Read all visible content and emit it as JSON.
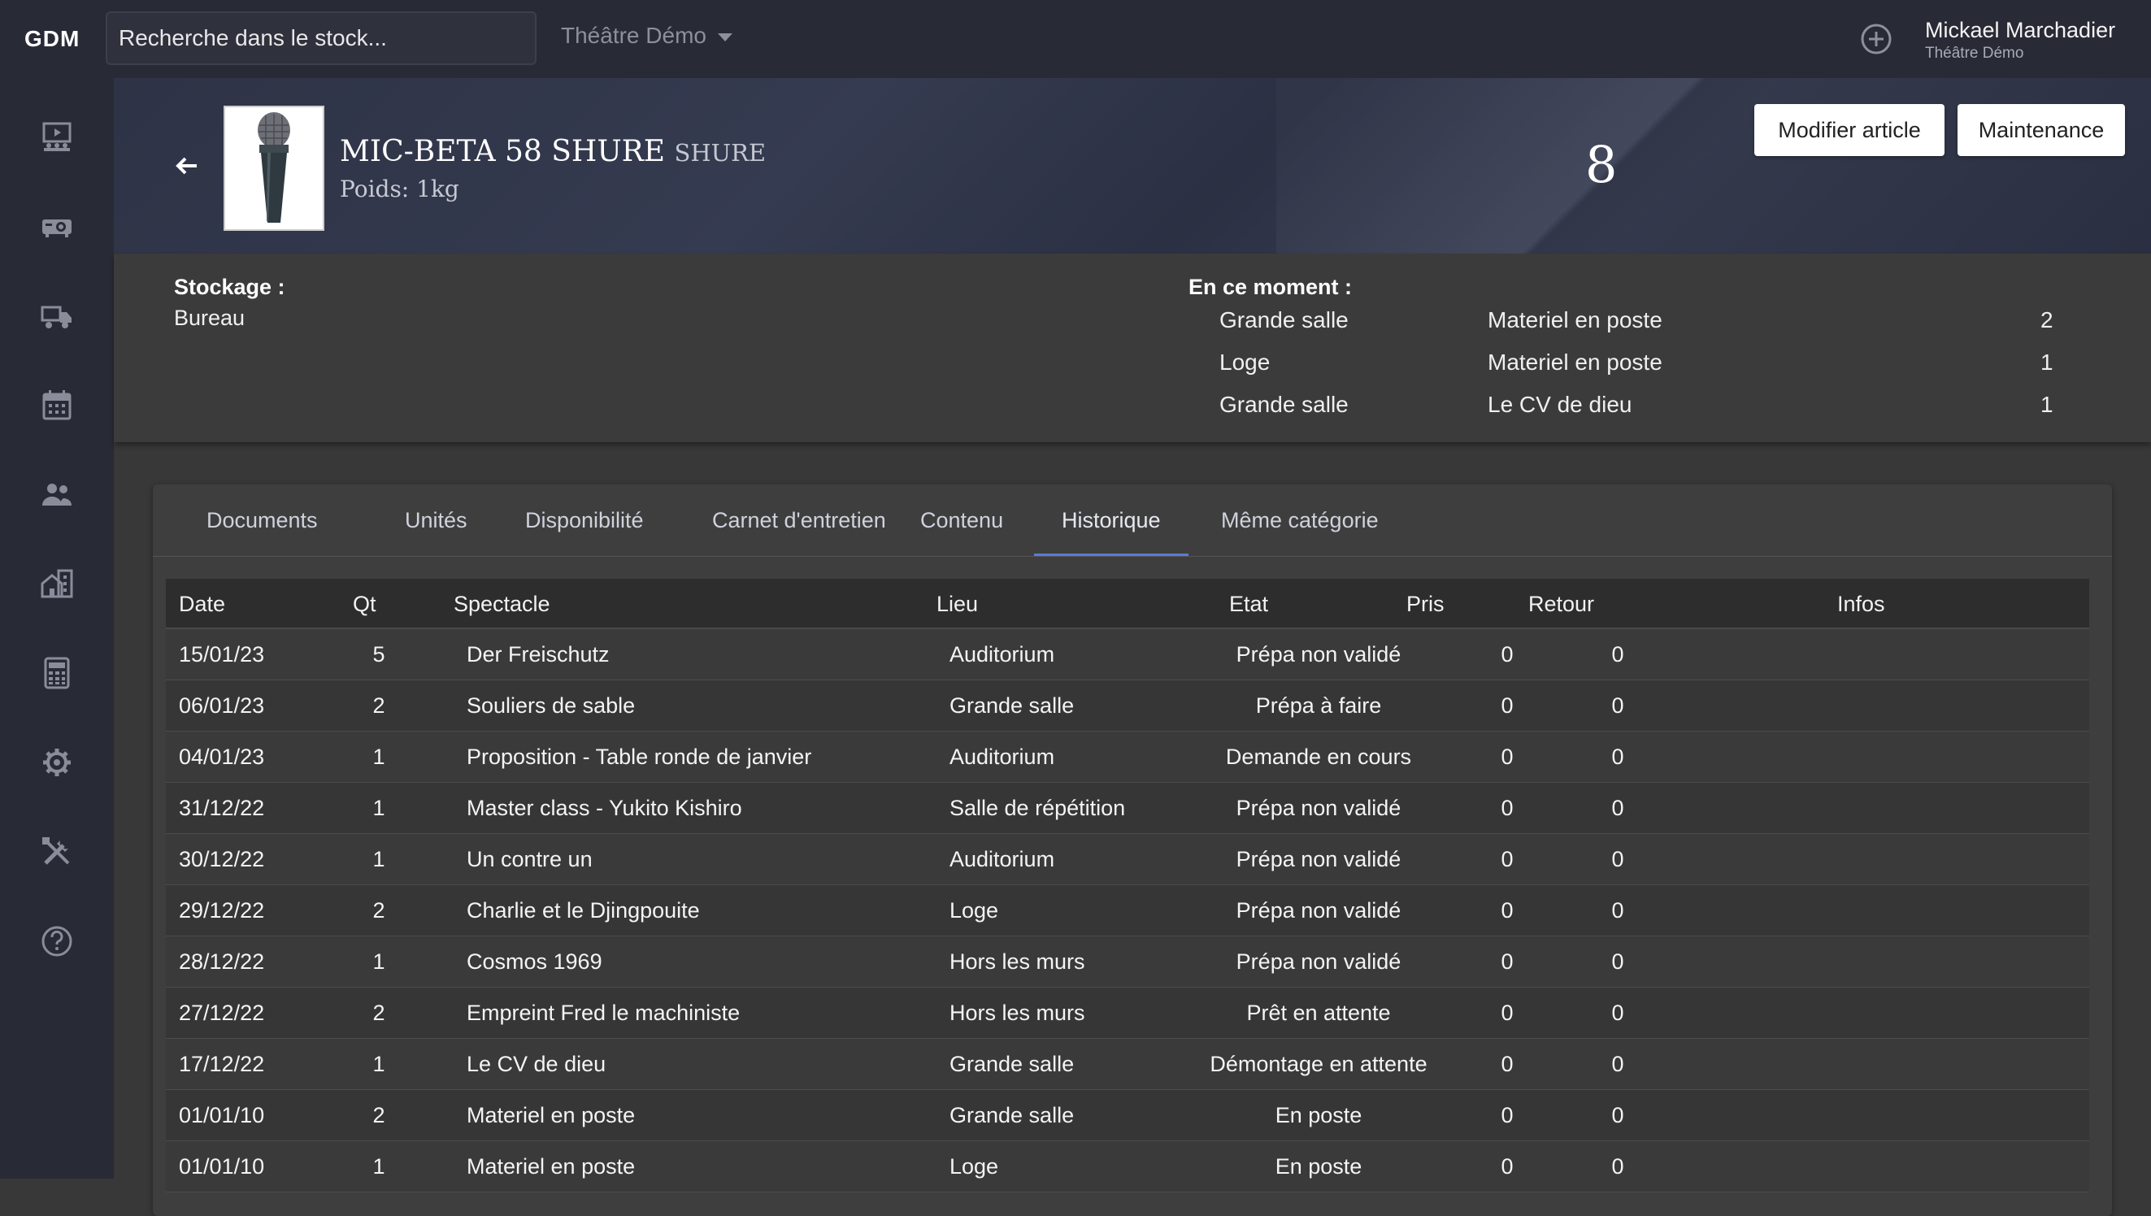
{
  "topbar": {
    "logo": "GDM",
    "search_placeholder": "Recherche dans le stock...",
    "venue": "Théâtre Démo",
    "user_name": "Mickael Marchadier",
    "user_sub": "Théâtre Démo"
  },
  "sidebar": {
    "icons": [
      "stage-icon",
      "projector-icon",
      "truck-icon",
      "calendar-icon",
      "people-icon",
      "building-icon",
      "calculator-icon",
      "gear-icon",
      "tools-icon",
      "help-icon"
    ]
  },
  "item": {
    "title": "MIC-BETA 58 SHURE",
    "brand": "SHURE",
    "weight": "Poids: 1kg",
    "count": "8",
    "edit_label": "Modifier article",
    "maintenance_label": "Maintenance"
  },
  "info": {
    "storage_label": "Stockage :",
    "storage_value": "Bureau",
    "moment_label": "En ce moment :",
    "moment_rows": [
      {
        "place": "Grande salle",
        "show": "Materiel en poste",
        "qty": "2"
      },
      {
        "place": "Loge",
        "show": "Materiel en poste",
        "qty": "1"
      },
      {
        "place": "Grande salle",
        "show": "Le CV de dieu",
        "qty": "1"
      }
    ]
  },
  "tabs": [
    "Documents",
    "Unités",
    "Disponibilité",
    "Carnet d'entretien",
    "Contenu",
    "Historique",
    "Même catégorie"
  ],
  "active_tab": "Historique",
  "table": {
    "headers": [
      "Date",
      "Qt",
      "Spectacle",
      "Lieu",
      "Etat",
      "Pris",
      "Retour",
      "Infos"
    ],
    "rows": [
      {
        "date": "15/01/23",
        "qt": "5",
        "show": "Der Freischutz",
        "place": "Auditorium",
        "state": "Prépa non validé",
        "pris": "0",
        "retour": "0"
      },
      {
        "date": "06/01/23",
        "qt": "2",
        "show": "Souliers de sable",
        "place": "Grande salle",
        "state": "Prépa à faire",
        "pris": "0",
        "retour": "0"
      },
      {
        "date": "04/01/23",
        "qt": "1",
        "show": "Proposition - Table ronde de janvier",
        "place": "Auditorium",
        "state": "Demande en cours",
        "pris": "0",
        "retour": "0"
      },
      {
        "date": "31/12/22",
        "qt": "1",
        "show": "Master class - Yukito Kishiro",
        "place": "Salle de répétition",
        "state": "Prépa non validé",
        "pris": "0",
        "retour": "0"
      },
      {
        "date": "30/12/22",
        "qt": "1",
        "show": "Un contre un",
        "place": "Auditorium",
        "state": "Prépa non validé",
        "pris": "0",
        "retour": "0"
      },
      {
        "date": "29/12/22",
        "qt": "2",
        "show": "Charlie et le Djingpouite",
        "place": "Loge",
        "state": "Prépa non validé",
        "pris": "0",
        "retour": "0"
      },
      {
        "date": "28/12/22",
        "qt": "1",
        "show": "Cosmos 1969",
        "place": "Hors les murs",
        "state": "Prépa non validé",
        "pris": "0",
        "retour": "0"
      },
      {
        "date": "27/12/22",
        "qt": "2",
        "show": "Empreint Fred le machiniste",
        "place": "Hors les murs",
        "state": "Prêt en attente",
        "pris": "0",
        "retour": "0"
      },
      {
        "date": "17/12/22",
        "qt": "1",
        "show": "Le CV de dieu",
        "place": "Grande salle",
        "state": "Démontage en attente",
        "pris": "0",
        "retour": "0"
      },
      {
        "date": "01/01/10",
        "qt": "2",
        "show": "Materiel en poste",
        "place": "Grande salle",
        "state": "En poste",
        "pris": "0",
        "retour": "0"
      },
      {
        "date": "01/01/10",
        "qt": "1",
        "show": "Materiel en poste",
        "place": "Loge",
        "state": "En poste",
        "pris": "0",
        "retour": "0"
      }
    ]
  }
}
